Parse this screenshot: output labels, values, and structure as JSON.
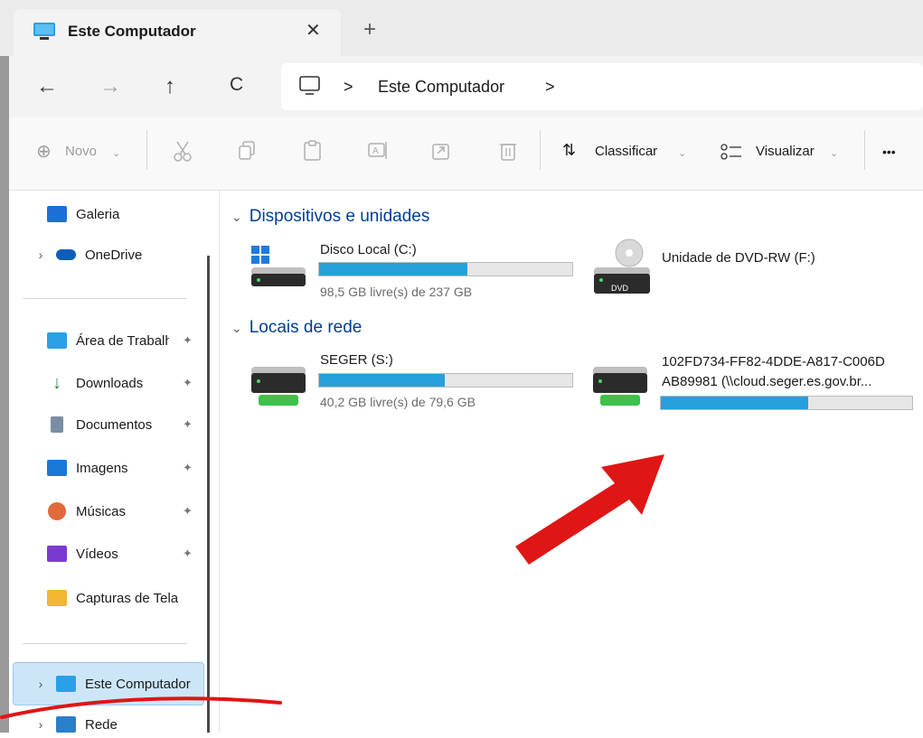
{
  "window": {
    "tab_title": "Este Computador",
    "close_glyph": "✕",
    "new_tab_glyph": "+"
  },
  "nav": {
    "back": "←",
    "forward": "→",
    "up": "↑",
    "refresh": "C",
    "breadcrumb": [
      "Este Computador"
    ],
    "separator": ">"
  },
  "toolbar": {
    "new_label": "Novo",
    "sort_label": "Classificar",
    "view_label": "Visualizar",
    "more_label": "•••"
  },
  "sidebar": {
    "items": [
      {
        "label": "Galeria",
        "icon": "gallery-icon",
        "color": "#1d6fd6"
      },
      {
        "label": "OneDrive",
        "icon": "cloud-icon",
        "color": "#0f5db8"
      },
      {
        "label": "Área de Trabalho",
        "icon": "desktop-icon",
        "color": "#2aa0e6"
      },
      {
        "label": "Downloads",
        "icon": "download-icon",
        "color": "#1f8a4c"
      },
      {
        "label": "Documentos",
        "icon": "document-icon",
        "color": "#7a8ea3"
      },
      {
        "label": "Imagens",
        "icon": "pictures-icon",
        "color": "#1a78d6"
      },
      {
        "label": "Músicas",
        "icon": "music-icon",
        "color": "#e06a3a"
      },
      {
        "label": "Vídeos",
        "icon": "videos-icon",
        "color": "#7a3ad1"
      },
      {
        "label": "Capturas de Tela",
        "icon": "folder-icon",
        "color": "#f2b632"
      },
      {
        "label": "Este Computador",
        "icon": "computer-icon",
        "color": "#2aa0e6"
      },
      {
        "label": "Rede",
        "icon": "network-icon",
        "color": "#2a7fc9"
      }
    ],
    "pin_glyph": "📌",
    "chevron": "›"
  },
  "content": {
    "sections": [
      {
        "title": "Dispositivos e unidades",
        "drives": [
          {
            "name": "Disco Local (C:)",
            "sub": "98,5 GB livre(s) de 237 GB",
            "used_fraction": 0.585
          },
          {
            "name": "Unidade de DVD-RW (F:)",
            "sub": "",
            "badge": "DVD"
          }
        ]
      },
      {
        "title": "Locais de rede",
        "drives": [
          {
            "name": "SEGER (S:)",
            "sub": "40,2 GB livre(s) de 79,6 GB",
            "used_fraction": 0.495
          },
          {
            "name": "102FD734-FF82-4DDE-A817-C006D",
            "name2": "AB89981 (\\\\cloud.seger.es.gov.br...",
            "sub": "",
            "used_fraction": 0.585
          }
        ]
      }
    ]
  },
  "colors": {
    "accent": "#26a0da",
    "section_title": "#003e92",
    "annotation": "#e01515"
  }
}
